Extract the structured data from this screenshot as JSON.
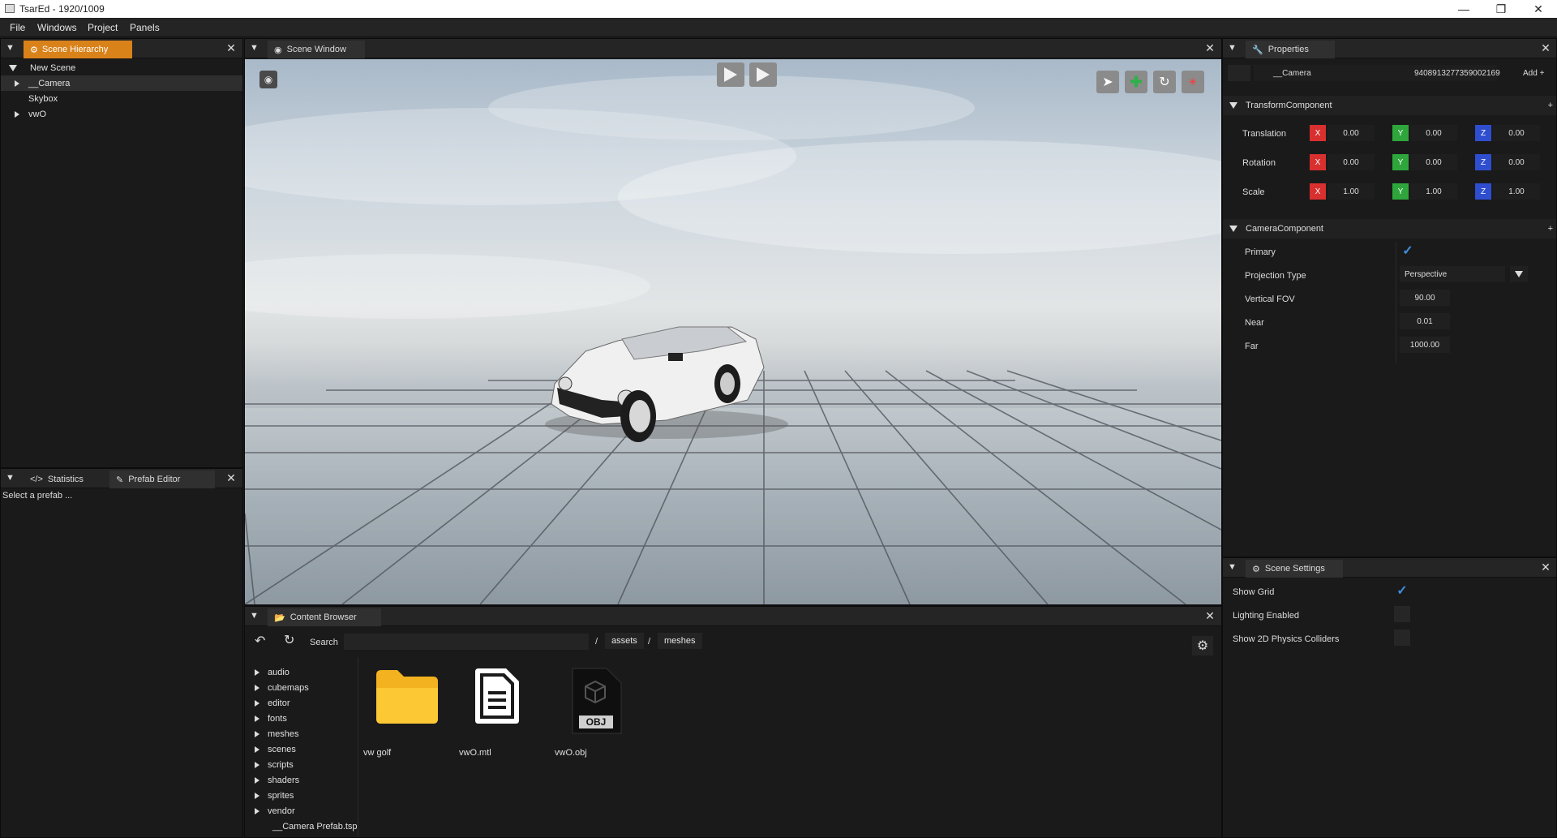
{
  "window": {
    "title": "TsarEd - 1920/1009"
  },
  "menu": [
    "File",
    "Windows",
    "Project",
    "Panels"
  ],
  "hierarchy": {
    "tab_label": "Scene Hierarchy",
    "items": [
      {
        "label": "New Scene",
        "expanded": true
      },
      {
        "label": "__Camera",
        "collapsed": true,
        "selected": true
      },
      {
        "label": "Skybox"
      },
      {
        "label": "vwO",
        "collapsed": true
      }
    ]
  },
  "bottom_left": {
    "tabs": [
      "Statistics",
      "Prefab Editor"
    ],
    "text": "Select a prefab ..."
  },
  "scene_window": {
    "tab_label": "Scene Window"
  },
  "properties": {
    "tab_label": "Properties",
    "entity_name": "__Camera",
    "entity_id": "9408913277359002169",
    "add_label": "Add +",
    "transform": {
      "header": "TransformComponent",
      "rows": [
        {
          "label": "Translation",
          "x": "0.00",
          "y": "0.00",
          "z": "0.00"
        },
        {
          "label": "Rotation",
          "x": "0.00",
          "y": "0.00",
          "z": "0.00"
        },
        {
          "label": "Scale",
          "x": "1.00",
          "y": "1.00",
          "z": "1.00"
        }
      ],
      "axis_labels": {
        "x": "X",
        "y": "Y",
        "z": "Z"
      },
      "plus": "+"
    },
    "camera": {
      "header": "CameraComponent",
      "primary_label": "Primary",
      "primary": true,
      "projection_label": "Projection Type",
      "projection_value": "Perspective",
      "fov_label": "Vertical FOV",
      "fov_value": "90.00",
      "near_label": "Near",
      "near_value": "0.01",
      "far_label": "Far",
      "far_value": "1000.00",
      "plus": "+"
    }
  },
  "scene_settings": {
    "tab_label": "Scene Settings",
    "items": [
      {
        "label": "Show Grid",
        "checked": true
      },
      {
        "label": "Lighting Enabled",
        "checked": false
      },
      {
        "label": "Show 2D Physics Colliders",
        "checked": false
      }
    ]
  },
  "content_browser": {
    "tab_label": "Content Browser",
    "search_label": "Search",
    "search_value": "",
    "breadcrumb": [
      "assets",
      "meshes"
    ],
    "separator": "/",
    "tree": [
      "audio",
      "cubemaps",
      "editor",
      "fonts",
      "meshes",
      "scenes",
      "scripts",
      "shaders",
      "sprites",
      "vendor"
    ],
    "tree_file": "__Camera Prefab.tsp",
    "assets": [
      {
        "name": "vw golf",
        "icon": "folder-icon"
      },
      {
        "name": "vwO.mtl",
        "icon": "document-icon"
      },
      {
        "name": "vwO.obj",
        "icon": "obj-file-icon"
      }
    ],
    "obj_badge": "OBJ"
  },
  "colors": {
    "accent_tab": "#d9821a",
    "axis_x": "#d8302f",
    "axis_y": "#2ea63c",
    "axis_z": "#2f4ecf",
    "check": "#3d8fe0",
    "folder": "#f7bd2a"
  }
}
